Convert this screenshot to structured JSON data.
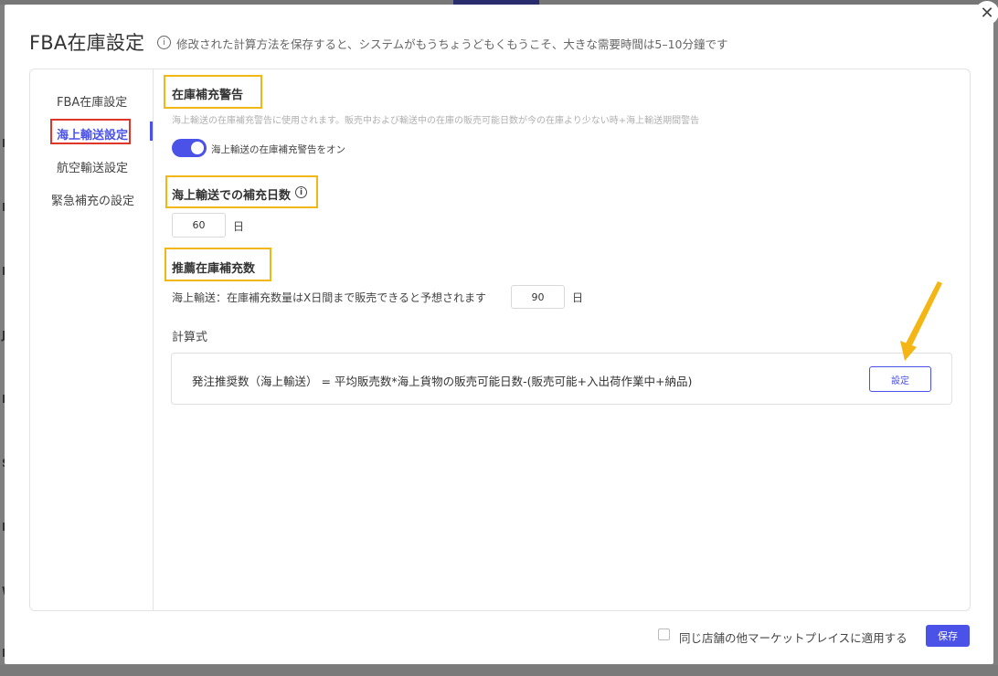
{
  "modal": {
    "title": "FBA在庫設定",
    "description": "修改された計算方法を保存すると、システムがもうちょうどもくもうこそ、大きな需要時間は5–10分鐘です",
    "close_symbol": "✕",
    "info_symbol": "i"
  },
  "sidebar": {
    "items": [
      {
        "label": "FBA在庫設定"
      },
      {
        "label": "海上輸送設定"
      },
      {
        "label": "航空輸送設定"
      },
      {
        "label": "緊急補充の設定"
      }
    ]
  },
  "restock_alert": {
    "title": "在庫補充警告",
    "hint": "海上輸送の在庫補充警告に使用されます。販売中および輸送中の在庫の販売可能日数が今の在庫より少ない時+海上輸送期間警告",
    "toggle_on": true,
    "toggle_label": "海上輸送の在庫補充警告をオン"
  },
  "replenish_days": {
    "title": "海上輸送での補充日数",
    "value": "60",
    "unit": "日"
  },
  "recommended": {
    "title": "推薦在庫補充数",
    "sentence": "海上輸送：在庫補充数量はX日間まで販売できると予想されます",
    "value": "90",
    "unit": "日"
  },
  "formula": {
    "title": "計算式",
    "text": "発注推奨数（海上輸送） = 平均販売数*海上貨物の販売可能日数-(販売可能+入出荷作業中+納品)",
    "button": "設定"
  },
  "footer": {
    "apply_label": "同じ店舗の他マーケットプレイスに適用する",
    "apply_checked": false,
    "save": "保存"
  },
  "colors": {
    "accent": "#4a52e8",
    "highlight_yellow": "#f0b715",
    "highlight_red": "#e0362a"
  },
  "background_app": {
    "row_letters": [
      "N",
      "N",
      "P",
      "J",
      "E",
      "S",
      "N",
      "W",
      "E"
    ]
  }
}
